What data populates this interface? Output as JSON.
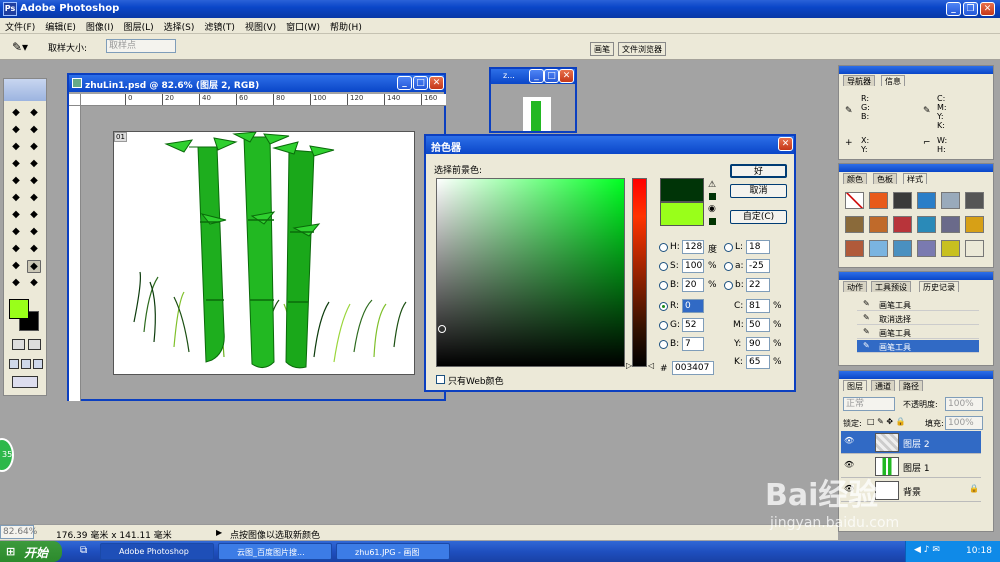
{
  "app": {
    "title": "Adobe Photoshop"
  },
  "menu": [
    "文件(F)",
    "编辑(E)",
    "图像(I)",
    "图层(L)",
    "选择(S)",
    "滤镜(T)",
    "视图(V)",
    "窗口(W)",
    "帮助(H)"
  ],
  "options": {
    "sample_size_label": "取样大小:",
    "sample_size_value": "取样点",
    "tab_brush": "画笔",
    "tab_file_browser": "文件浏览器"
  },
  "document": {
    "title": "zhuLin1.psd @ 82.6% (图层 2, RGB)",
    "ruler_ticks": [
      "0",
      "20",
      "40",
      "60",
      "80",
      "100",
      "120",
      "140",
      "160"
    ],
    "layer_tag": "01"
  },
  "small_doc": {
    "title": "z..."
  },
  "picker": {
    "title": "拾色器",
    "prompt": "选择前景色:",
    "ok": "好",
    "cancel": "取消",
    "custom": "自定(C)",
    "labels": {
      "H": "H:",
      "S": "S:",
      "B": "B:",
      "R": "R:",
      "G": "G:",
      "Bb": "B:",
      "L": "L:",
      "a": "a:",
      "b": "b:",
      "C": "C:",
      "M": "M:",
      "Y": "Y:",
      "K": "K:"
    },
    "values": {
      "H": "128",
      "S": "100",
      "B": "20",
      "R": "0",
      "G": "52",
      "Bb": "7",
      "L": "18",
      "a": "-25",
      "b": "22",
      "C": "81",
      "M": "50",
      "Y": "90",
      "K": "65"
    },
    "units": {
      "deg": "度",
      "pct": "%"
    },
    "hex_label": "#",
    "hex": "003407",
    "web_only": "只有Web颜色",
    "colors": {
      "new": "#003407",
      "old": "#99ff1a"
    }
  },
  "panels": {
    "navigator": {
      "tabs": [
        "导航器",
        "信息"
      ],
      "rgb": "R:\nG:\nB:",
      "cmyk": "C:\nM:\nY:\nK:",
      "xy": "X:\nY:",
      "wh": "W:\nH:"
    },
    "swatches": {
      "tabs": [
        "颜色",
        "色板",
        "样式"
      ]
    },
    "history": {
      "tabs": [
        "动作",
        "工具预设",
        "历史记录"
      ],
      "items": [
        "画笔工具",
        "取消选择",
        "画笔工具",
        "画笔工具"
      ]
    },
    "layers": {
      "tabs": [
        "图层",
        "通道",
        "路径"
      ],
      "mode": "正常",
      "opacity_label": "不透明度:",
      "opacity": "100%",
      "lock_label": "锁定:",
      "fill_label": "填充:",
      "fill": "100%",
      "items": [
        "图层 2",
        "图层 1",
        "背景"
      ]
    }
  },
  "status": {
    "zoom": "82.64%",
    "size": "176.39 毫米 x 141.11 毫米",
    "hint": "点按图像以选取新颜色"
  },
  "taskbar": {
    "start": "开始",
    "tasks": [
      "Adobe Photoshop",
      "云图_百度图片搜...",
      "zhu61.JPG - 画图"
    ],
    "time": "10:18"
  },
  "watermark": {
    "brand": "Bai经验",
    "url": "jingyan.baidu.com"
  }
}
